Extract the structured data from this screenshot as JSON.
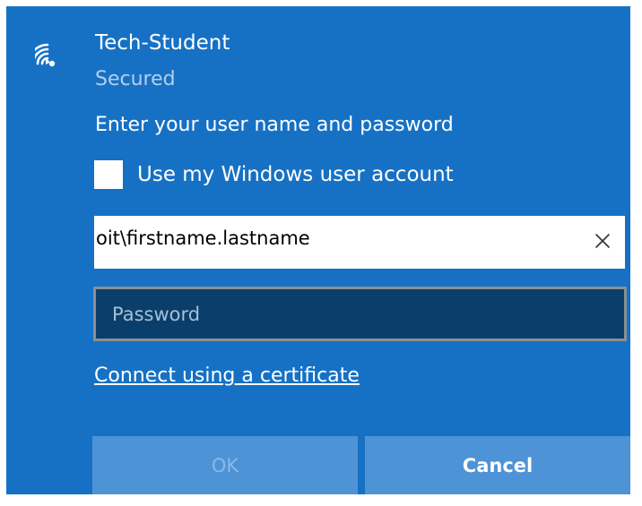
{
  "network": {
    "name": "Tech-Student",
    "status": "Secured",
    "icon": "wifi-signal-icon"
  },
  "credentials": {
    "prompt": "Enter your user name and password",
    "use_windows_account": {
      "label": "Use my Windows user account",
      "checked": false
    },
    "username": {
      "value": "oit\\firstname.lastname",
      "clear_icon": "close-icon"
    },
    "password": {
      "value": "",
      "placeholder": "Password"
    },
    "certificate_link": "Connect using a certificate"
  },
  "buttons": {
    "ok_label": "OK",
    "cancel_label": "Cancel"
  },
  "colors": {
    "panel_background": "#1671c4",
    "password_field_background": "#0a3f6b",
    "button_background": "#4e93d6",
    "disabled_text": "#8ab9e6",
    "secondary_text": "#b4cfe9"
  }
}
